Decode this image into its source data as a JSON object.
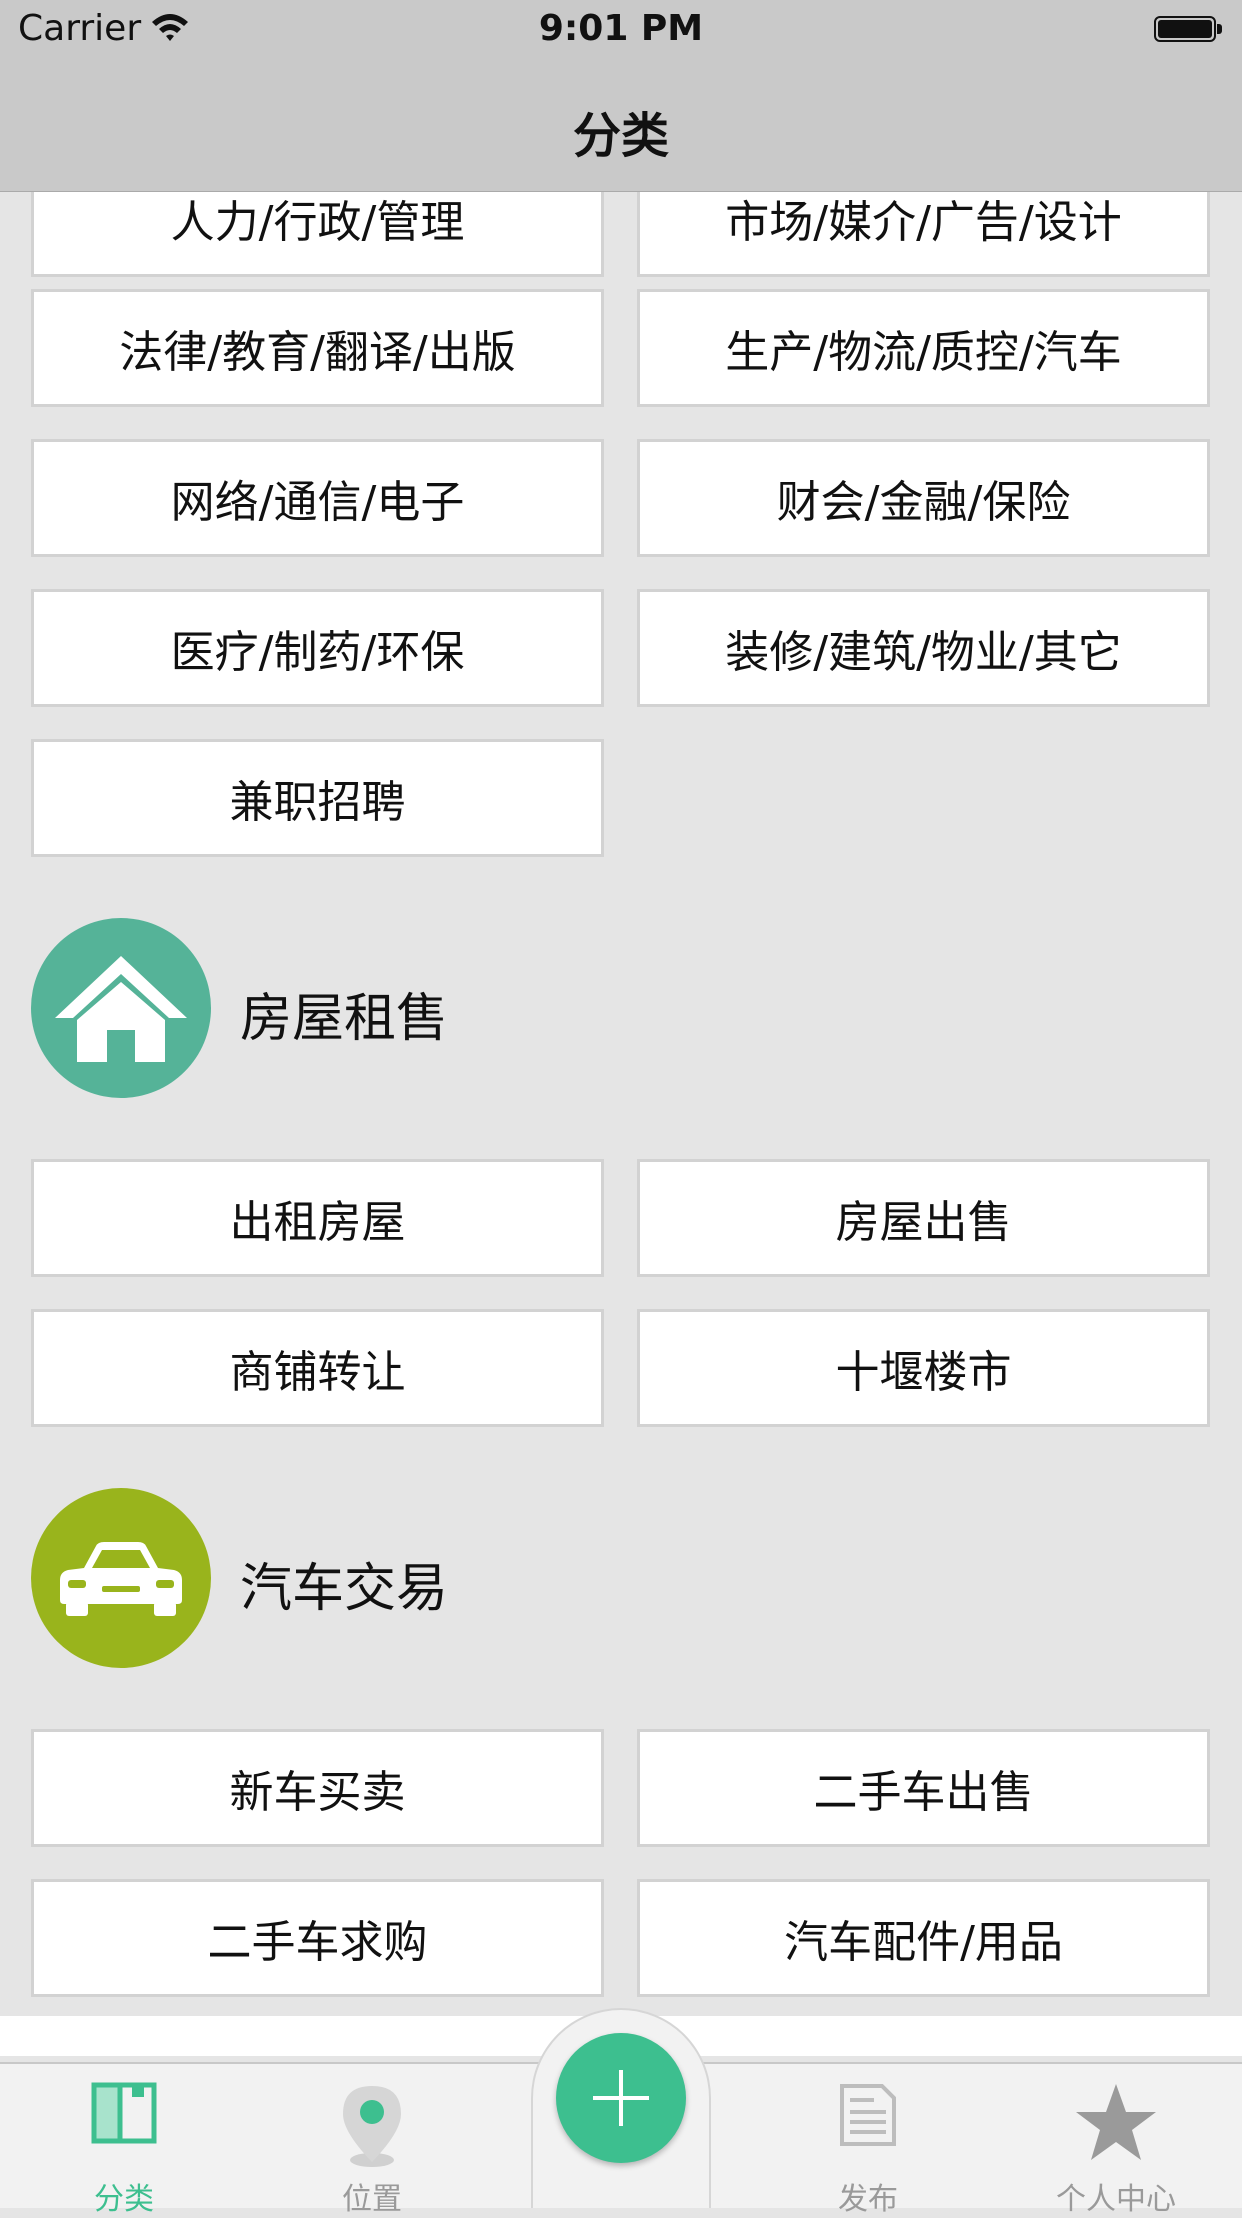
{
  "status_bar": {
    "carrier": "Carrier",
    "time": "9:01 PM"
  },
  "nav": {
    "title": "分类"
  },
  "jobs_items": [
    "人力/行政/管理",
    "市场/媒介/广告/设计",
    "法律/教育/翻译/出版",
    "生产/物流/质控/汽车",
    "网络/通信/电子",
    "财会/金融/保险",
    "医疗/制药/环保",
    "装修/建筑/物业/其它",
    "兼职招聘"
  ],
  "housing": {
    "title": "房屋租售",
    "icon": "house-icon",
    "color": "#55b398",
    "items": [
      "出租房屋",
      "房屋出售",
      "商铺转让",
      "十堰楼市"
    ]
  },
  "cars": {
    "title": "汽车交易",
    "icon": "car-icon",
    "color": "#99b41c",
    "items": [
      "新车买卖",
      "二手车出售",
      "二手车求购",
      "汽车配件/用品"
    ]
  },
  "tabs": [
    {
      "label": "分类",
      "icon": "category-icon",
      "active": true
    },
    {
      "label": "位置",
      "icon": "location-pin-icon",
      "active": false
    },
    {
      "label": "发布",
      "icon": "document-icon",
      "active": false
    },
    {
      "label": "个人中心",
      "icon": "star-icon",
      "active": false
    }
  ],
  "center_action": {
    "icon": "plus-icon",
    "color": "#3dbf8f"
  },
  "accent_color": "#3dbf8f"
}
